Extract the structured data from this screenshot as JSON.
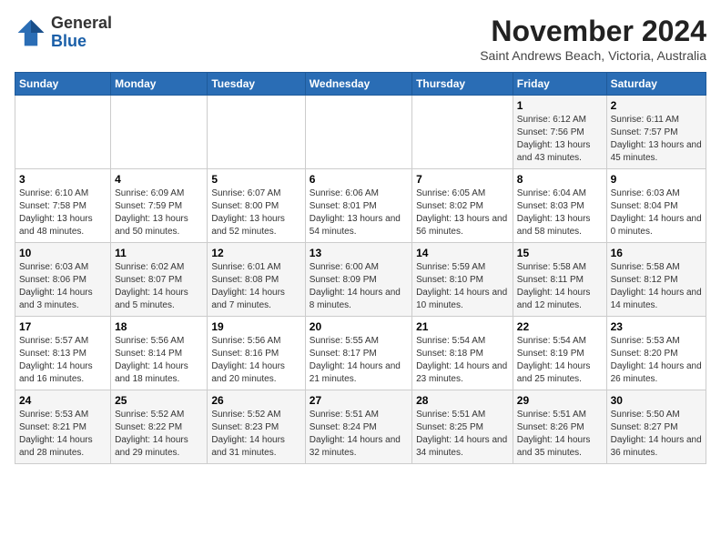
{
  "header": {
    "logo_line1": "General",
    "logo_line2": "Blue",
    "month": "November 2024",
    "location": "Saint Andrews Beach, Victoria, Australia"
  },
  "weekdays": [
    "Sunday",
    "Monday",
    "Tuesday",
    "Wednesday",
    "Thursday",
    "Friday",
    "Saturday"
  ],
  "weeks": [
    [
      {
        "day": "",
        "info": ""
      },
      {
        "day": "",
        "info": ""
      },
      {
        "day": "",
        "info": ""
      },
      {
        "day": "",
        "info": ""
      },
      {
        "day": "",
        "info": ""
      },
      {
        "day": "1",
        "info": "Sunrise: 6:12 AM\nSunset: 7:56 PM\nDaylight: 13 hours and 43 minutes."
      },
      {
        "day": "2",
        "info": "Sunrise: 6:11 AM\nSunset: 7:57 PM\nDaylight: 13 hours and 45 minutes."
      }
    ],
    [
      {
        "day": "3",
        "info": "Sunrise: 6:10 AM\nSunset: 7:58 PM\nDaylight: 13 hours and 48 minutes."
      },
      {
        "day": "4",
        "info": "Sunrise: 6:09 AM\nSunset: 7:59 PM\nDaylight: 13 hours and 50 minutes."
      },
      {
        "day": "5",
        "info": "Sunrise: 6:07 AM\nSunset: 8:00 PM\nDaylight: 13 hours and 52 minutes."
      },
      {
        "day": "6",
        "info": "Sunrise: 6:06 AM\nSunset: 8:01 PM\nDaylight: 13 hours and 54 minutes."
      },
      {
        "day": "7",
        "info": "Sunrise: 6:05 AM\nSunset: 8:02 PM\nDaylight: 13 hours and 56 minutes."
      },
      {
        "day": "8",
        "info": "Sunrise: 6:04 AM\nSunset: 8:03 PM\nDaylight: 13 hours and 58 minutes."
      },
      {
        "day": "9",
        "info": "Sunrise: 6:03 AM\nSunset: 8:04 PM\nDaylight: 14 hours and 0 minutes."
      }
    ],
    [
      {
        "day": "10",
        "info": "Sunrise: 6:03 AM\nSunset: 8:06 PM\nDaylight: 14 hours and 3 minutes."
      },
      {
        "day": "11",
        "info": "Sunrise: 6:02 AM\nSunset: 8:07 PM\nDaylight: 14 hours and 5 minutes."
      },
      {
        "day": "12",
        "info": "Sunrise: 6:01 AM\nSunset: 8:08 PM\nDaylight: 14 hours and 7 minutes."
      },
      {
        "day": "13",
        "info": "Sunrise: 6:00 AM\nSunset: 8:09 PM\nDaylight: 14 hours and 8 minutes."
      },
      {
        "day": "14",
        "info": "Sunrise: 5:59 AM\nSunset: 8:10 PM\nDaylight: 14 hours and 10 minutes."
      },
      {
        "day": "15",
        "info": "Sunrise: 5:58 AM\nSunset: 8:11 PM\nDaylight: 14 hours and 12 minutes."
      },
      {
        "day": "16",
        "info": "Sunrise: 5:58 AM\nSunset: 8:12 PM\nDaylight: 14 hours and 14 minutes."
      }
    ],
    [
      {
        "day": "17",
        "info": "Sunrise: 5:57 AM\nSunset: 8:13 PM\nDaylight: 14 hours and 16 minutes."
      },
      {
        "day": "18",
        "info": "Sunrise: 5:56 AM\nSunset: 8:14 PM\nDaylight: 14 hours and 18 minutes."
      },
      {
        "day": "19",
        "info": "Sunrise: 5:56 AM\nSunset: 8:16 PM\nDaylight: 14 hours and 20 minutes."
      },
      {
        "day": "20",
        "info": "Sunrise: 5:55 AM\nSunset: 8:17 PM\nDaylight: 14 hours and 21 minutes."
      },
      {
        "day": "21",
        "info": "Sunrise: 5:54 AM\nSunset: 8:18 PM\nDaylight: 14 hours and 23 minutes."
      },
      {
        "day": "22",
        "info": "Sunrise: 5:54 AM\nSunset: 8:19 PM\nDaylight: 14 hours and 25 minutes."
      },
      {
        "day": "23",
        "info": "Sunrise: 5:53 AM\nSunset: 8:20 PM\nDaylight: 14 hours and 26 minutes."
      }
    ],
    [
      {
        "day": "24",
        "info": "Sunrise: 5:53 AM\nSunset: 8:21 PM\nDaylight: 14 hours and 28 minutes."
      },
      {
        "day": "25",
        "info": "Sunrise: 5:52 AM\nSunset: 8:22 PM\nDaylight: 14 hours and 29 minutes."
      },
      {
        "day": "26",
        "info": "Sunrise: 5:52 AM\nSunset: 8:23 PM\nDaylight: 14 hours and 31 minutes."
      },
      {
        "day": "27",
        "info": "Sunrise: 5:51 AM\nSunset: 8:24 PM\nDaylight: 14 hours and 32 minutes."
      },
      {
        "day": "28",
        "info": "Sunrise: 5:51 AM\nSunset: 8:25 PM\nDaylight: 14 hours and 34 minutes."
      },
      {
        "day": "29",
        "info": "Sunrise: 5:51 AM\nSunset: 8:26 PM\nDaylight: 14 hours and 35 minutes."
      },
      {
        "day": "30",
        "info": "Sunrise: 5:50 AM\nSunset: 8:27 PM\nDaylight: 14 hours and 36 minutes."
      }
    ]
  ]
}
